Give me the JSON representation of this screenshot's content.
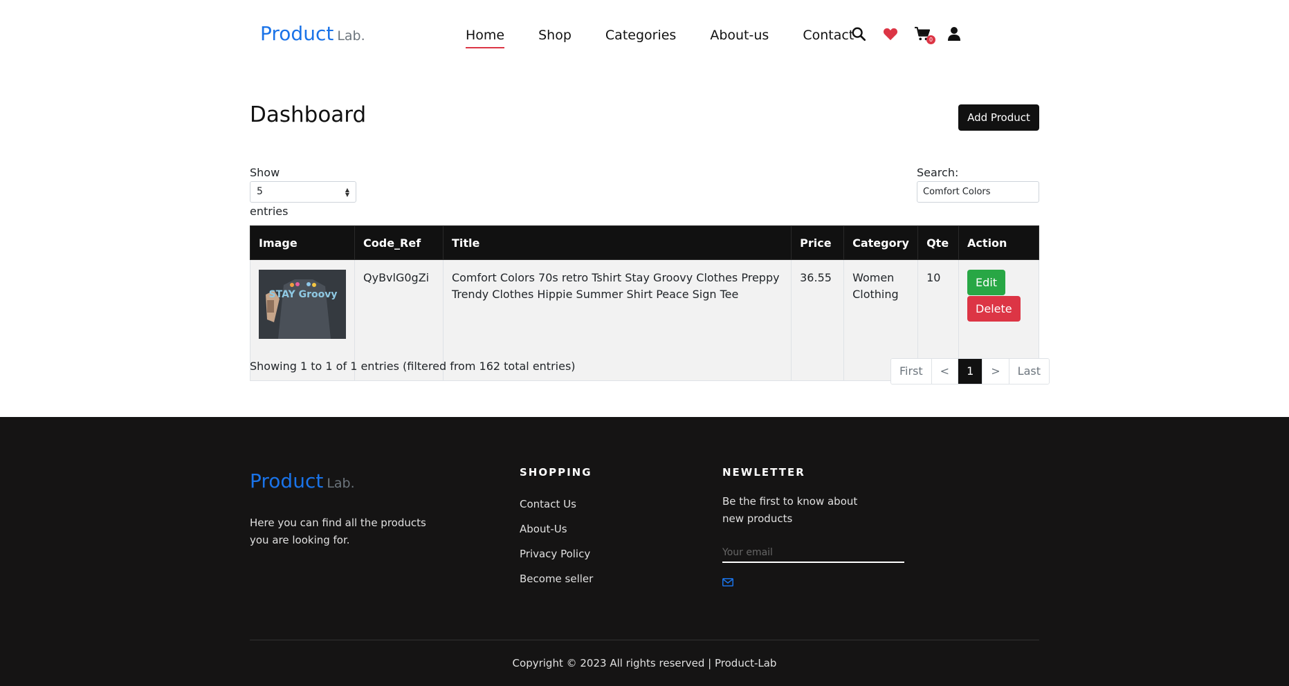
{
  "brand": {
    "name": "Product",
    "suffix": "Lab."
  },
  "nav": {
    "links": [
      "Home",
      "Shop",
      "Categories",
      "About-us",
      "Contact"
    ],
    "active": "Home",
    "icons": [
      "search-icon",
      "heart-icon",
      "cart-icon",
      "user-icon"
    ],
    "cart_count": "0"
  },
  "dashboard": {
    "title": "Dashboard",
    "add_button": "Add Product",
    "show_label": "Show",
    "entries_value": "5",
    "entries_label": "entries",
    "search_label": "Search:",
    "search_value": "Comfort Colors"
  },
  "table": {
    "columns": [
      "Image",
      "Code_Ref",
      "Title",
      "Price",
      "Category",
      "Qte",
      "Action"
    ],
    "rows": [
      {
        "image_alt": "STAY Groovy",
        "code_ref": "QyBvlG0gZi",
        "title": "Comfort Colors 70s retro Tshirt Stay Groovy Clothes Preppy Trendy Clothes Hippie Summer Shirt Peace Sign Tee",
        "price": "36.55",
        "category": "Women Clothing",
        "qte": "10",
        "edit_label": "Edit",
        "delete_label": "Delete"
      }
    ],
    "info": "Showing 1 to 1 of 1 entries (filtered from 162 total entries)",
    "pagination": [
      "First",
      "<",
      "1",
      ">",
      "Last"
    ],
    "current_page": "1"
  },
  "footer": {
    "description": "Here you can find all the products you are looking for.",
    "shopping_heading": "SHOPPING",
    "shopping_links": [
      "Contact Us",
      "About-Us",
      "Privacy Policy",
      "Become seller"
    ],
    "newsletter_heading": "NEWLETTER",
    "newsletter_text": "Be the first to know about new products",
    "email_placeholder": "Your email",
    "copyright": "Copyright © 2023 All rights reserved | Product-Lab"
  },
  "colors": {
    "accent": "#1a73e8",
    "dark": "#111111",
    "footer_bg": "#151414",
    "danger": "#dc3545",
    "success": "#28a745"
  }
}
